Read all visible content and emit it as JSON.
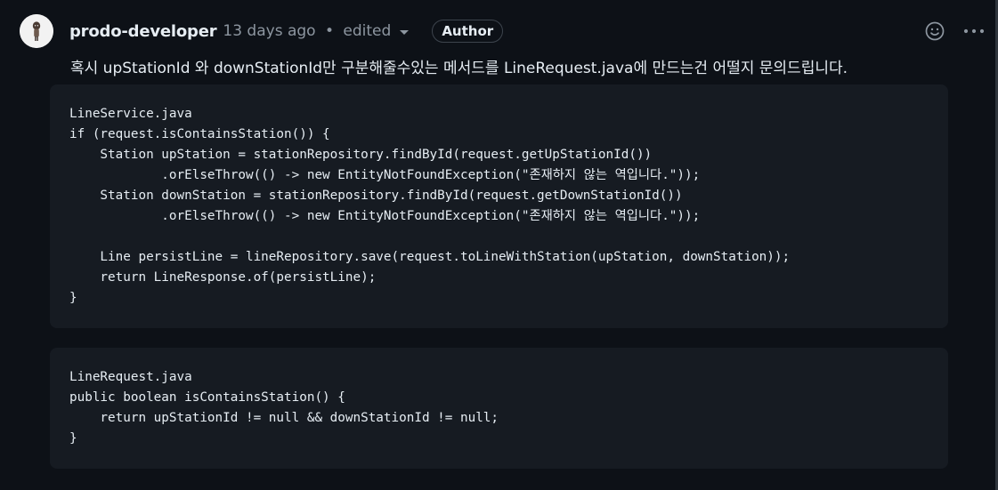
{
  "comment": {
    "author": "prodo-developer",
    "time_ago": "13 days ago",
    "separator": "•",
    "edited_label": "edited",
    "badge": "Author",
    "body": "혹시 upStationId 와 downStationId만 구분해줄수있는 메서드를 LineRequest.java에 만드는건 어떨지 문의드립니다.",
    "actions": {
      "reaction_icon": "smiley-icon",
      "menu_icon": "kebab-menu-icon"
    }
  },
  "code_blocks": [
    {
      "code": "LineService.java\nif (request.isContainsStation()) {\n    Station upStation = stationRepository.findById(request.getUpStationId())\n            .orElseThrow(() -> new EntityNotFoundException(\"존재하지 않는 역입니다.\"));\n    Station downStation = stationRepository.findById(request.getDownStationId())\n            .orElseThrow(() -> new EntityNotFoundException(\"존재하지 않는 역입니다.\"));\n\n    Line persistLine = lineRepository.save(request.toLineWithStation(upStation, downStation));\n    return LineResponse.of(persistLine);\n}"
    },
    {
      "code": "LineRequest.java\npublic boolean isContainsStation() {\n    return upStationId != null && downStationId != null;\n}"
    }
  ],
  "colors": {
    "background": "#0d1117",
    "code_background": "#161b22",
    "text": "#e6edf3",
    "muted": "#8d96a0",
    "border": "#3d444d"
  }
}
